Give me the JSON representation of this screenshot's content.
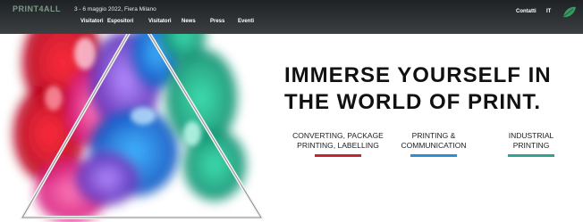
{
  "header": {
    "logo_text": "PRINT4ALL",
    "event_info": "3 - 6 maggio 2022, Fiera Milano",
    "nav": [
      "Visitatori",
      "Espositori",
      "Visitatori",
      "News",
      "Press",
      "Eventi"
    ],
    "contacts": "Contatti",
    "language": "IT"
  },
  "hero": {
    "headline_line1": "IMMERSE YOURSELF IN",
    "headline_line2": "THE WORLD OF PRINT."
  },
  "categories": [
    {
      "line1": "CONVERTING, PACKAGE",
      "line2": "PRINTING, LABELLING",
      "color": "#c8262f"
    },
    {
      "line1": "PRINTING &",
      "line2": "COMMUNICATION",
      "color": "#2a8fd6"
    },
    {
      "line1": "INDUSTRIAL",
      "line2": "PRINTING",
      "color": "#2ba590"
    }
  ],
  "icons": {
    "corner": "leaf-icon"
  }
}
